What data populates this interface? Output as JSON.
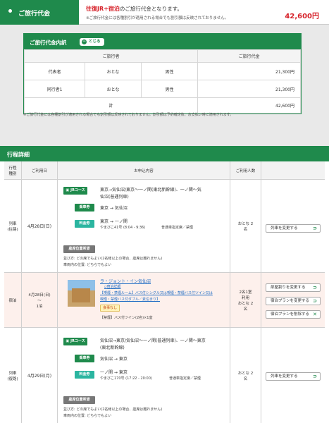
{
  "price_bar": {
    "label": "ご旅行代金",
    "message_prefix": "往復JR+宿泊",
    "message_suffix": "のご旅行代金となります。",
    "note": "※ご旅行代金には各種割引が適用される場合でも割引額は反映されておりません。",
    "amount": "42,600円"
  },
  "breakdown": {
    "title": "ご旅行代金内訳",
    "toggle_label": "とじる",
    "headers": [
      "ご旅行者",
      "ご旅行代金"
    ],
    "rows": [
      {
        "role": "代表者",
        "age": "おとな",
        "gender": "男性",
        "price": "21,300円"
      },
      {
        "role": "同行者1",
        "age": "おとな",
        "gender": "男性",
        "price": "21,300円"
      }
    ],
    "total_label": "計",
    "total": "42,600円",
    "note": "※ご旅行代金には各種割引が適用される場合でも割引額は反映されておりません。割引額は予約確定後、お支払い時に適用されます。"
  },
  "itinerary": {
    "title": "行程詳細",
    "headers": [
      "行程\n種別",
      "ご利用日",
      "お申込内容",
      "ご利用人数"
    ],
    "rows": [
      {
        "type": "列車\n(往路)",
        "date": "4月28日(日)",
        "jr_badge": "JRコース",
        "route_line1": "東京→気仙沼/東京〜一ノ関(東北新幹線)、一ノ関〜気",
        "route_line2": "仙沼(普通列車)",
        "board_label": "乗車券",
        "board_route": "東京 → 気仙沼",
        "fare_label": "料金券",
        "fare_route": "東京 → 一ノ関",
        "train": "やまびこ41号 (8:04 - 9:36)",
        "train_seat": "普通車指定席／禁煙",
        "seat_badge": "座席位置希望",
        "seat_line1": "並び方: どの席でもよい(2名様以上の場合、座席は離れません)",
        "seat_line2": "車両内の位置: どちらでもよい",
        "people": "おとな 2\n名",
        "action": "列車を変更する"
      },
      {
        "type": "宿泊",
        "date": "4月28日(日)\n〜\n1泊",
        "hotel_name": "ラ・ジョント・イン気仙沼",
        "hotel_detail": "宿泊詳細",
        "plan_line1": "【喫煙・禁煙ルーム】バス付シングル又は喫煙・禁煙バス付ツイン又は",
        "plan_line2": "喫煙・禁煙バス付ダブル／素泊まり】",
        "meal_badge": "食事なし",
        "room_info": "【禁煙】バス付ツイン(2名)×1室",
        "people": "2名1室\n利用\nおとな 2\n名",
        "actions": [
          "部屋割りを変更する",
          "宿泊プランを変更する",
          "宿泊プランを削除する"
        ]
      },
      {
        "type": "列車\n(復路)",
        "date": "4月29日(月)",
        "jr_badge": "JRコース",
        "route_line1": "気仙沼→東京/気仙沼〜一ノ関(普通列車)、一ノ関〜東京",
        "route_line2": "(東北新幹線)",
        "board_label": "乗車券",
        "board_route": "気仙沼 → 東京",
        "fare_label": "料金券",
        "fare_route": "一ノ関 → 東京",
        "train": "やまびこ170号 (17:22 - 20:00)",
        "train_seat": "普通車指定席／禁煙",
        "seat_badge": "座席位置希望",
        "seat_line1": "並び方: どの席でもよい(2名様以上の場合、座席は離れません)",
        "seat_line2": "車両内の位置: どちらでもよい",
        "people": "おとな 2\n名",
        "action": "列車を変更する"
      }
    ]
  },
  "colors": {
    "brand_green": "#1f8a4c",
    "price_red": "#d6222a",
    "stay_bg": "#fdf0ec"
  }
}
